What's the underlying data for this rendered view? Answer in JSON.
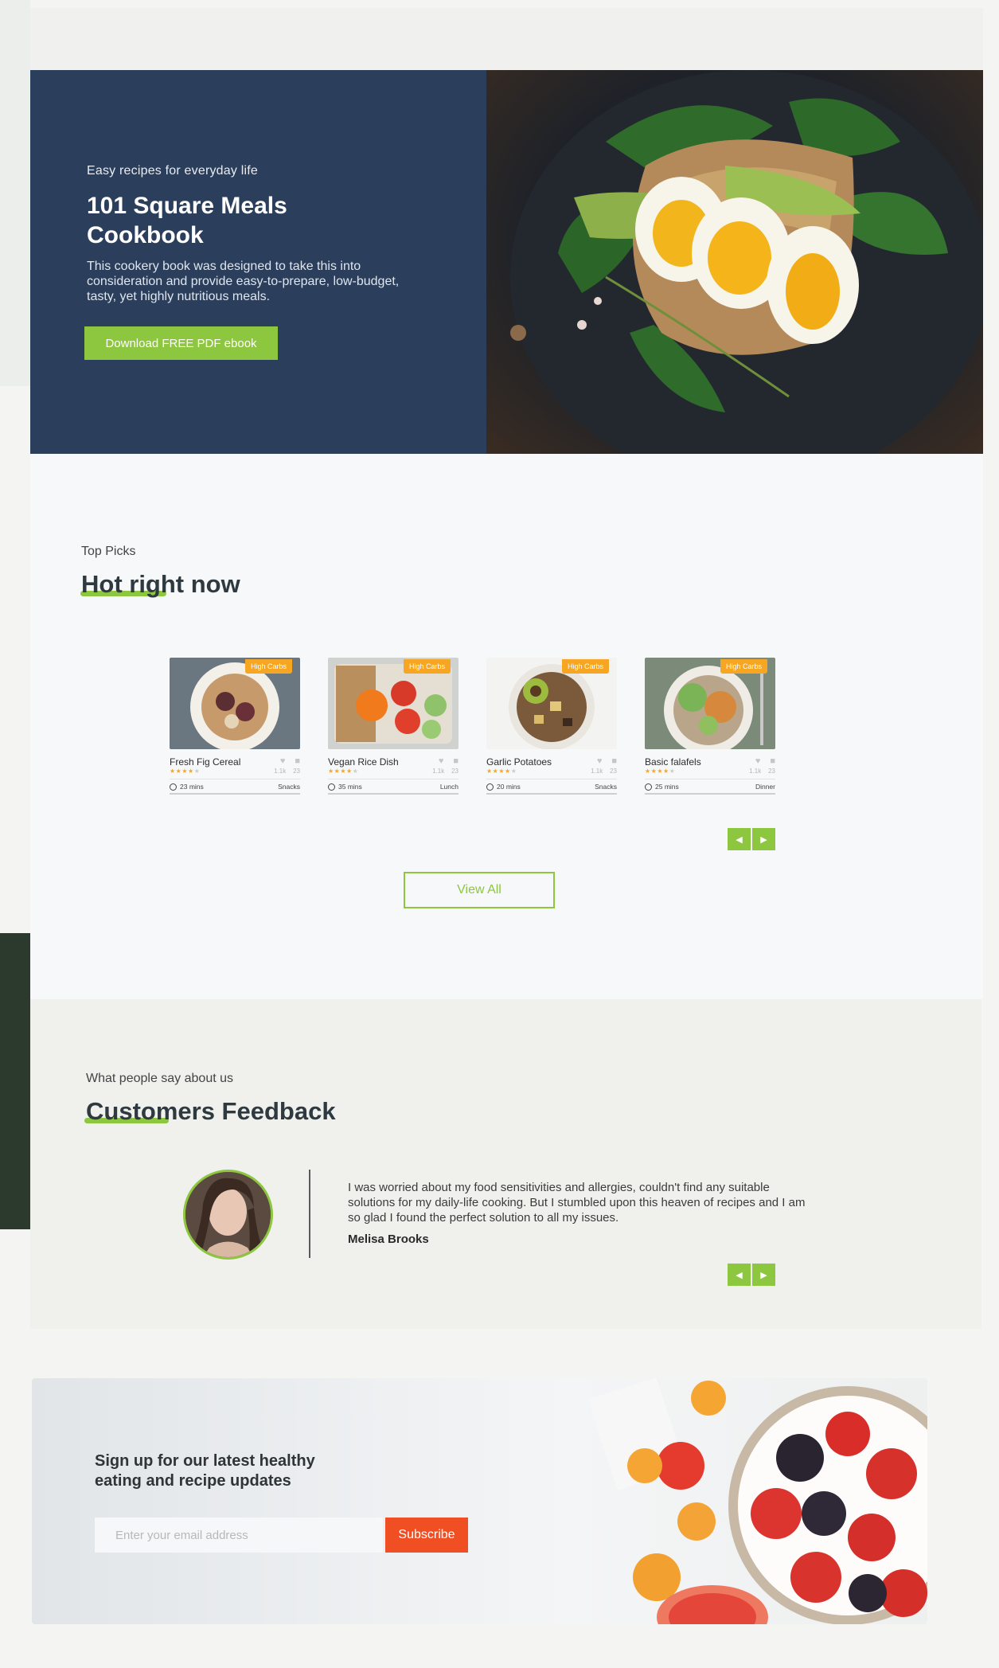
{
  "hero": {
    "tagline": "Easy recipes for everyday life",
    "title": "101 Square Meals Cookbook",
    "description": "This cookery book was designed to take this into consideration and provide easy-to-prepare, low-budget, tasty, yet highly nutritious meals.",
    "button_label": "Download FREE PDF ebook"
  },
  "top_picks": {
    "subtitle": "Top Picks",
    "title": "Hot right now",
    "cards": [
      {
        "badge": "High Carbs",
        "name": "Fresh Fig Cereal",
        "likes": "1.1k",
        "comments": "23",
        "rating": 4,
        "time": "23 mins",
        "category": "Snacks"
      },
      {
        "badge": "High Carbs",
        "name": "Vegan Rice Dish",
        "likes": "1.1k",
        "comments": "23",
        "rating": 4,
        "time": "35 mins",
        "category": "Lunch"
      },
      {
        "badge": "High Carbs",
        "name": "Garlic Potatoes",
        "likes": "1.1k",
        "comments": "23",
        "rating": 4,
        "time": "20 mins",
        "category": "Snacks"
      },
      {
        "badge": "High Carbs",
        "name": "Basic falafels",
        "likes": "1.1k",
        "comments": "23",
        "rating": 4,
        "time": "25 mins",
        "category": "Dinner"
      }
    ],
    "view_all_label": "View All"
  },
  "feedback": {
    "subtitle": "What people say about us",
    "title": "Customers Feedback",
    "quote": "I was worried about my food sensitivities and allergies, couldn't find any suitable solutions for my daily-life cooking. But I stumbled upon this heaven of recipes and I am so glad I found the perfect solution to all my issues.",
    "author": "Melisa Brooks"
  },
  "newsletter": {
    "title": "Sign up for our latest healthy eating and recipe updates",
    "input_placeholder": "Enter your email address",
    "button_label": "Subscribe"
  },
  "colors": {
    "accent": "#8dc63f",
    "hero_bg": "#2b3f5c",
    "badge": "#f6a623",
    "subscribe": "#f04e23"
  }
}
